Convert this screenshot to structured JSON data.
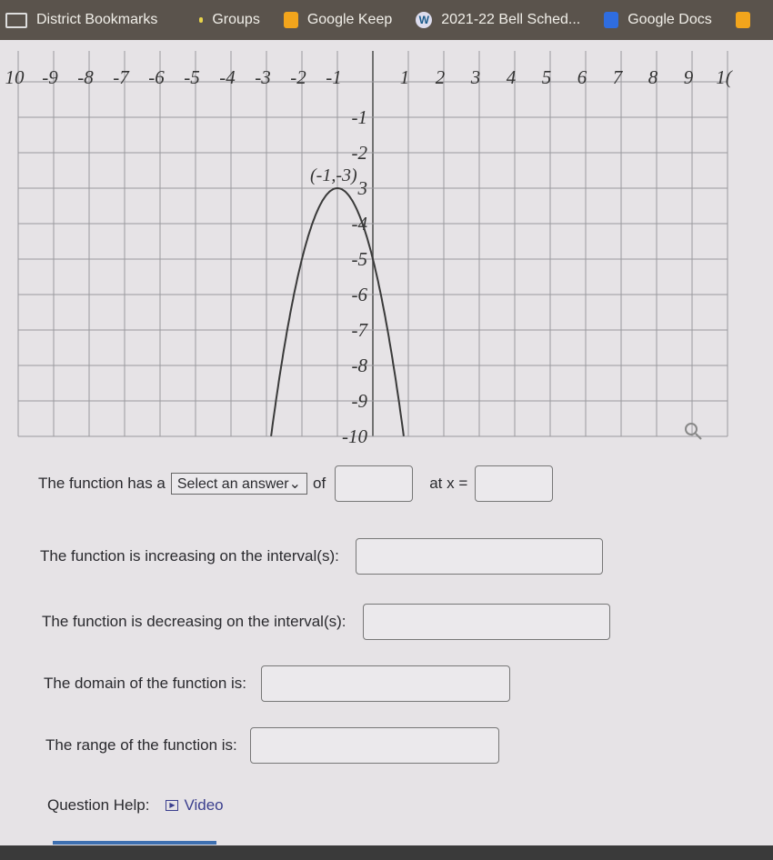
{
  "bookmarks": [
    {
      "label": "District Bookmarks",
      "icon": "folder-icon"
    },
    {
      "label": "Groups",
      "icon": "groups-icon"
    },
    {
      "label": "Google Keep",
      "icon": "google-keep-icon"
    },
    {
      "label": "2021-22 Bell Sched...",
      "icon": "wordpress-icon"
    },
    {
      "label": "Google Docs",
      "icon": "google-docs-icon"
    }
  ],
  "chart_data": {
    "type": "line",
    "xlim": [
      -10,
      10
    ],
    "ylim": [
      -10,
      0
    ],
    "x_ticks": [
      "10",
      "-9",
      "-8",
      "-7",
      "-6",
      "-5",
      "-4",
      "-3",
      "-2",
      "-1",
      "1",
      "2",
      "3",
      "4",
      "5",
      "6",
      "7",
      "8",
      "9",
      "1("
    ],
    "y_ticks": [
      "-1",
      "-2",
      "3",
      "-4",
      "-5",
      "-6",
      "-7",
      "-8",
      "-9",
      "-10"
    ],
    "vertex": {
      "x": -1,
      "y": -3,
      "label": "(-1,-3)"
    },
    "grid": true,
    "color": "#3a3a3a"
  },
  "questions": {
    "q1_prefix": "The function has a",
    "q1_select": "Select an answer",
    "q1_of": "of",
    "q1_at": "at x =",
    "q2": "The function is increasing on the interval(s):",
    "q3": "The function is decreasing on the interval(s):",
    "q4": "The domain of the function is:",
    "q5": "The range of the function is:"
  },
  "help": {
    "label": "Question Help:",
    "video": "Video"
  }
}
